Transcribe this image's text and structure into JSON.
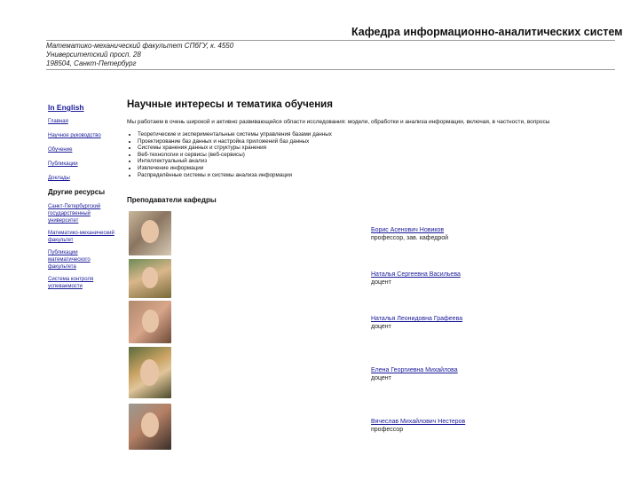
{
  "header": {
    "title": "Кафедра информационно-аналитических систем",
    "address_lines": [
      "Математико-механический факультет СПбГУ, к. 4550",
      "Университетский просп. 28",
      "198504, Санкт-Петербург"
    ]
  },
  "sidebar": {
    "english_link": "In English",
    "nav": [
      "Главная",
      "Научное руководство",
      "Обучение",
      "Публикации",
      "Доклады"
    ],
    "other_heading": "Другие ресурсы",
    "resources": [
      "Санкт-Петербургский государственный университет",
      "Математико-механический факультет",
      "Публикации математического факультета",
      "Система контроля успеваемости"
    ]
  },
  "main": {
    "heading": "Научные интересы и тематика обучения",
    "intro": "Мы работаем в очень широкой и активно развивающейся области исследования: модели, обработки и анализа информации, включая, в частности, вопросы",
    "interests": [
      "Теоретические и экспериментальные системы управления базами данных",
      "Проектирование баз данных и настройка приложений баз данных",
      "Системы хранения данных и структуры хранения",
      "Веб-технологии и сервисы (веб-сервисы)",
      "Интеллектуальный анализ",
      "Извлечение информации",
      "Распределённые системы и системы анализа информации"
    ],
    "staff_heading": "Преподаватели кафедры",
    "staff": [
      {
        "name": "Борис Асенович Новиков",
        "role": "профессор, зав. кафедрой"
      },
      {
        "name": "Наталья Сергеевна Васильева",
        "role": "доцент"
      },
      {
        "name": "Наталья Леонидовна Графеева",
        "role": "доцент"
      },
      {
        "name": "Елена Георгиевна Михайлова",
        "role": "доцент"
      },
      {
        "name": "Вячеслав Михайлович Нестеров",
        "role": "профессор"
      }
    ]
  },
  "colors": {
    "link": "#1a1a9a",
    "rule": "#9a9a9a",
    "text": "#111111"
  }
}
